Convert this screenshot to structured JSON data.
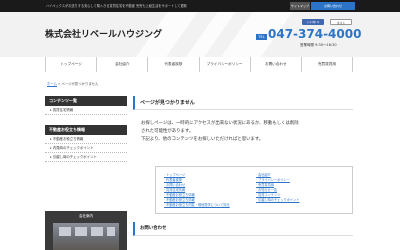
{
  "topbar": {
    "tagline": "ハイペックスがお送りする安心して購入きる賃貸住宅を不動産 完売も上級生活をサポートして更新",
    "sitemap": "サイトマップ",
    "contact": "お問い合わせ"
  },
  "header": {
    "company": "株式会社リベールハウジング",
    "like": "いいね! 0",
    "post": "ポスト",
    "tel_label": "TEL",
    "tel": "047-374-4000",
    "hours": "営業時間 9:30～18:30"
  },
  "nav": [
    "トップページ",
    "会社紹介",
    "代表者挨拶",
    "プライバシーポリシー",
    "お問い合わせ",
    "売買賃貸用"
  ],
  "breadcrumb": {
    "home": "ホーム",
    "separator": "»",
    "current": "ページが見つかりません"
  },
  "sidebar": {
    "sections": [
      {
        "title": "コンテンツ一覧",
        "items": [
          "賃貸住宅情報"
        ]
      },
      {
        "title": "不動産お役立ち情報",
        "items": [
          "不動産お役立ち情報",
          "内見時のチェックポイント",
          "引越し時のチェックポイント"
        ]
      }
    ],
    "photo_label": "会社案内"
  },
  "main": {
    "title": "ページが見つかりません",
    "intro": [
      "お探しページは、一時的にアクセスが出来ない状況にあるか、移動もしくは削除",
      "された可能性があります。",
      "下記より、他のコンテンツをお探しいただければと思います。"
    ],
    "links_left": [
      "トップページ",
      "代表者挨拶",
      "お問い合わせ",
      "賃貸住宅情報",
      "不動産お役立ち情報",
      "不動産お役立ち情報",
      "不動産お役立ち内覧・現地見学について知る"
    ],
    "links_right": [
      "会社紹介",
      "プライバシーポリシー",
      "売買賃貸用",
      "お知らせ一覧",
      "賃貸コンテンツ",
      "引越し時のチェックポイント"
    ],
    "contact_title": "お問い合わせ"
  }
}
